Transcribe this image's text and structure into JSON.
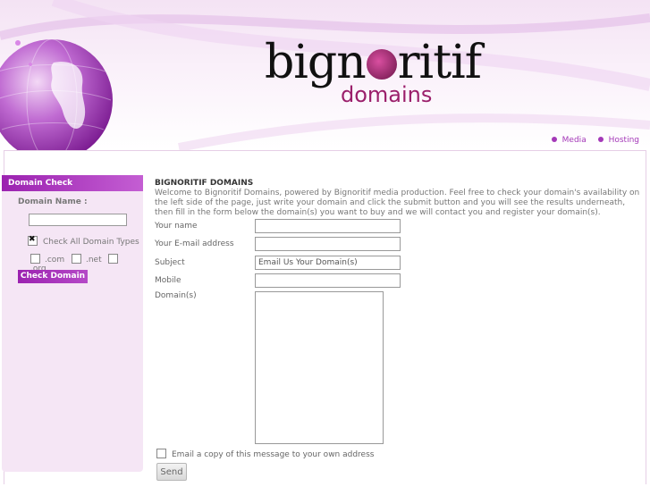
{
  "brand": {
    "name": "bignoritif",
    "name_before": "bign",
    "name_after": "ritif",
    "sub": "domains"
  },
  "topnav": {
    "items": [
      "Media",
      "Hosting"
    ]
  },
  "sidebar": {
    "title": "Domain Check",
    "domain_label": "Domain Name :",
    "check_all_label": "Check All Domain Types",
    "tlds": [
      ".com",
      ".net",
      ".org"
    ],
    "button_label": "Check Domain"
  },
  "main": {
    "heading": "BIGNORITIF DOMAINS",
    "intro": "Welcome to Bignoritif Domains, powered by Bignoritif media production. Feel free to check your domain's availability on the left side of the page, just write your domain and click the submit button and you will see the results underneath, then fill in the form below the domain(s) you want to buy and we will contact you and register your domain(s).",
    "form": {
      "name_label": "Your name",
      "email_label": "Your E-mail address",
      "subject_label": "Subject",
      "subject_value": "Email Us Your Domain(s)",
      "mobile_label": "Mobile",
      "domains_label": "Domain(s)",
      "copy_label": "Email a copy of this message to your own address",
      "send_label": "Send"
    }
  },
  "colors": {
    "accent": "#9b22b0",
    "logo_sub": "#9b1f6b",
    "sidebar_bg": "#f5e6f5"
  }
}
